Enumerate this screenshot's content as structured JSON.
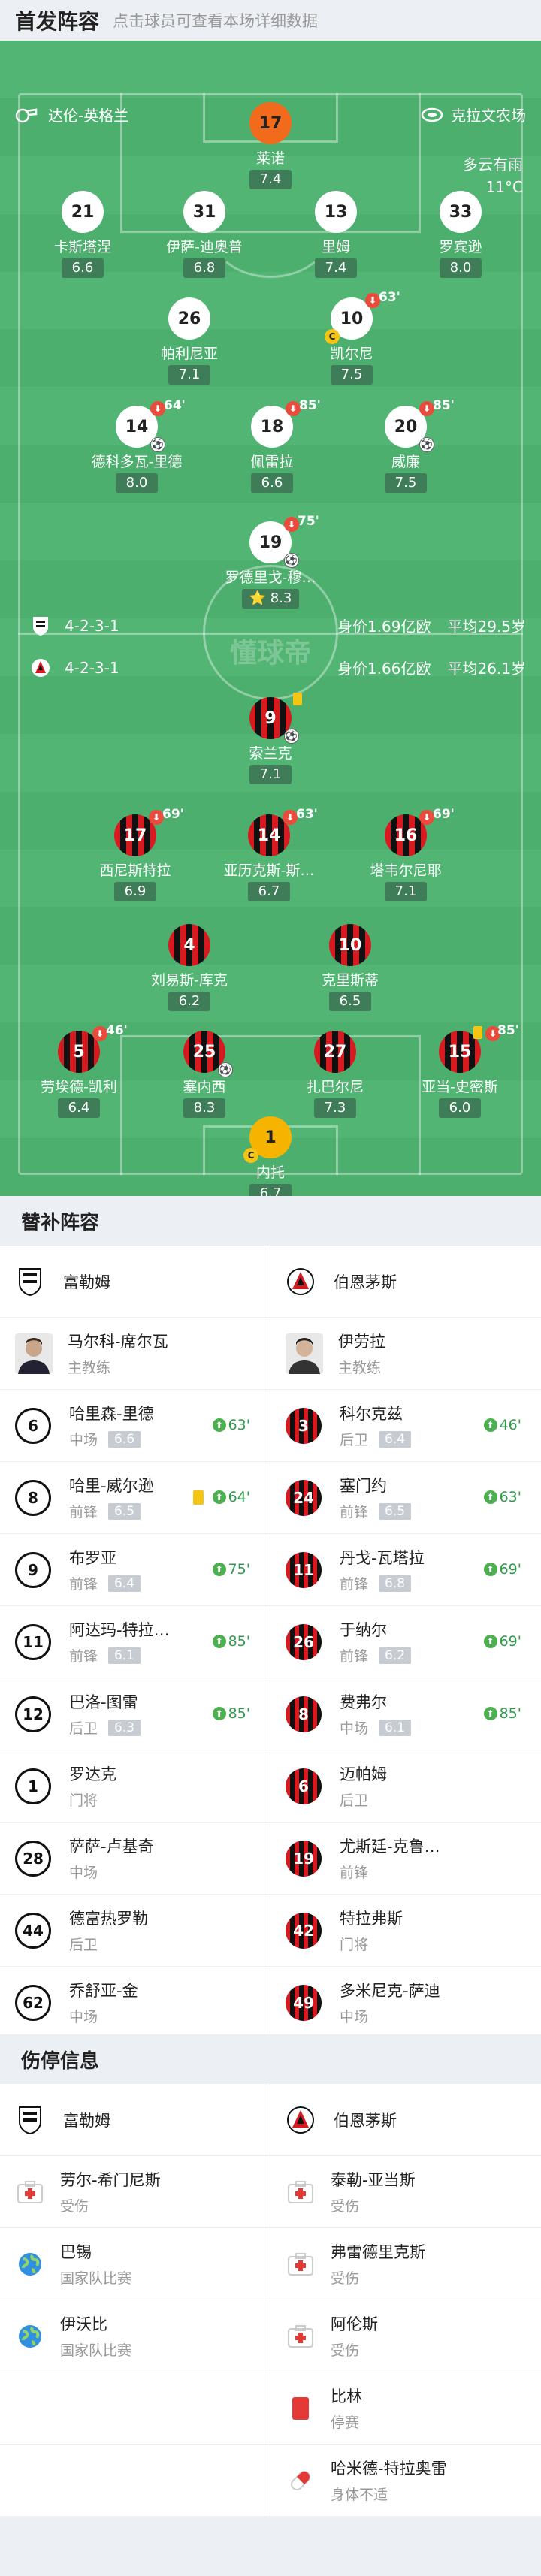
{
  "header": {
    "title": "首发阵容",
    "subtitle": "点击球员可查看本场详细数据"
  },
  "match": {
    "home_team": "达伦-英格兰",
    "stadium": "克拉文农场",
    "weather": "多云有雨",
    "temp": "11°C",
    "watermark": "懂球帝"
  },
  "home_lineup": [
    {
      "num": "17",
      "name": "莱诺",
      "rating": "7.4",
      "style": "gk-orange"
    },
    {
      "num": "21",
      "name": "卡斯塔涅",
      "rating": "6.6",
      "style": "white"
    },
    {
      "num": "31",
      "name": "伊萨-迪奥普",
      "rating": "6.8",
      "style": "white"
    },
    {
      "num": "13",
      "name": "里姆",
      "rating": "7.4",
      "style": "white"
    },
    {
      "num": "33",
      "name": "罗宾逊",
      "rating": "8.0",
      "style": "white"
    },
    {
      "num": "26",
      "name": "帕利尼亚",
      "rating": "7.1",
      "style": "white"
    },
    {
      "num": "10",
      "name": "凯尔尼",
      "rating": "7.5",
      "style": "white",
      "sub": "63'"
    },
    {
      "num": "14",
      "name": "德科多瓦-里德",
      "rating": "8.0",
      "style": "white",
      "sub": "64'"
    },
    {
      "num": "18",
      "name": "佩雷拉",
      "rating": "6.6",
      "style": "white",
      "sub": "85'"
    },
    {
      "num": "20",
      "name": "威廉",
      "rating": "7.5",
      "style": "white",
      "sub": "85'"
    },
    {
      "num": "19",
      "name": "罗德里戈-穆…",
      "rating": "8.3",
      "style": "white",
      "sub": "75'"
    }
  ],
  "formations": [
    {
      "formation": "4-2-3-1",
      "value": "身价1.69亿欧",
      "avg_age": "平均29.5岁"
    },
    {
      "formation": "4-2-3-1",
      "value": "身价1.66亿欧",
      "avg_age": "平均26.1岁"
    }
  ],
  "away_lineup": [
    {
      "num": "9",
      "name": "索兰克",
      "rating": "7.1",
      "style": "bou"
    },
    {
      "num": "17",
      "name": "西尼斯特拉",
      "rating": "6.9",
      "style": "bou",
      "sub": "69'"
    },
    {
      "num": "14",
      "name": "亚历克斯-斯…",
      "rating": "6.7",
      "style": "bou",
      "sub": "63'"
    },
    {
      "num": "16",
      "name": "塔韦尔尼耶",
      "rating": "7.1",
      "style": "bou",
      "sub": "69'"
    },
    {
      "num": "4",
      "name": "刘易斯-库克",
      "rating": "6.2",
      "style": "bou"
    },
    {
      "num": "10",
      "name": "克里斯蒂",
      "rating": "6.5",
      "style": "bou"
    },
    {
      "num": "5",
      "name": "劳埃德-凯利",
      "rating": "6.4",
      "style": "bou",
      "sub": "46'"
    },
    {
      "num": "25",
      "name": "塞内西",
      "rating": "8.3",
      "style": "bou"
    },
    {
      "num": "27",
      "name": "扎巴尔尼",
      "rating": "7.3",
      "style": "bou"
    },
    {
      "num": "15",
      "name": "亚当-史密斯",
      "rating": "6.0",
      "style": "bou",
      "sub": "85'"
    },
    {
      "num": "1",
      "name": "内托",
      "rating": "6.7",
      "style": "gk-yellow"
    }
  ],
  "subs_section": {
    "title": "替补阵容",
    "home_team": "富勒姆",
    "away_team": "伯恩茅斯",
    "home_coach": {
      "name": "马尔科-席尔瓦",
      "role": "主教练"
    },
    "away_coach": {
      "name": "伊劳拉",
      "role": "主教练"
    },
    "home": [
      {
        "num": "6",
        "name": "哈里森-里德",
        "pos": "中场",
        "rating": "6.6",
        "sub": "63'"
      },
      {
        "num": "8",
        "name": "哈里-威尔逊",
        "pos": "前锋",
        "rating": "6.5",
        "sub": "64'",
        "yellow": true
      },
      {
        "num": "9",
        "name": "布罗亚",
        "pos": "前锋",
        "rating": "6.4",
        "sub": "75'"
      },
      {
        "num": "11",
        "name": "阿达玛-特拉…",
        "pos": "前锋",
        "rating": "6.1",
        "sub": "85'"
      },
      {
        "num": "12",
        "name": "巴洛-图雷",
        "pos": "后卫",
        "rating": "6.3",
        "sub": "85'"
      },
      {
        "num": "1",
        "name": "罗达克",
        "pos": "门将"
      },
      {
        "num": "28",
        "name": "萨萨-卢基奇",
        "pos": "中场"
      },
      {
        "num": "44",
        "name": "德富热罗勒",
        "pos": "后卫"
      },
      {
        "num": "62",
        "name": "乔舒亚-金",
        "pos": "中场"
      }
    ],
    "away": [
      {
        "num": "3",
        "name": "科尔克兹",
        "pos": "后卫",
        "rating": "6.4",
        "sub": "46'"
      },
      {
        "num": "24",
        "name": "塞门约",
        "pos": "前锋",
        "rating": "6.5",
        "sub": "63'"
      },
      {
        "num": "11",
        "name": "丹戈-瓦塔拉",
        "pos": "前锋",
        "rating": "6.8",
        "sub": "69'"
      },
      {
        "num": "26",
        "name": "于纳尔",
        "pos": "前锋",
        "rating": "6.2",
        "sub": "69'"
      },
      {
        "num": "8",
        "name": "费弗尔",
        "pos": "中场",
        "rating": "6.1",
        "sub": "85'"
      },
      {
        "num": "6",
        "name": "迈帕姆",
        "pos": "后卫"
      },
      {
        "num": "19",
        "name": "尤斯廷-克鲁…",
        "pos": "前锋"
      },
      {
        "num": "42",
        "name": "特拉弗斯",
        "pos": "门将"
      },
      {
        "num": "49",
        "name": "多米尼克-萨迪",
        "pos": "中场"
      }
    ]
  },
  "injury_section": {
    "title": "伤停信息",
    "home_team": "富勒姆",
    "away_team": "伯恩茅斯",
    "home": [
      {
        "name": "劳尔-希门尼斯",
        "status": "受伤",
        "icon": "medkit-icon"
      },
      {
        "name": "巴锡",
        "status": "国家队比赛",
        "icon": "globe-icon"
      },
      {
        "name": "伊沃比",
        "status": "国家队比赛",
        "icon": "globe-icon"
      }
    ],
    "away": [
      {
        "name": "泰勒-亚当斯",
        "status": "受伤",
        "icon": "medkit-icon"
      },
      {
        "name": "弗雷德里克斯",
        "status": "受伤",
        "icon": "medkit-icon"
      },
      {
        "name": "阿伦斯",
        "status": "受伤",
        "icon": "medkit-icon"
      },
      {
        "name": "比林",
        "status": "停赛",
        "icon": "red-card-icon"
      },
      {
        "name": "哈米德-特拉奥雷",
        "status": "身体不适",
        "icon": "pill-icon"
      }
    ]
  }
}
